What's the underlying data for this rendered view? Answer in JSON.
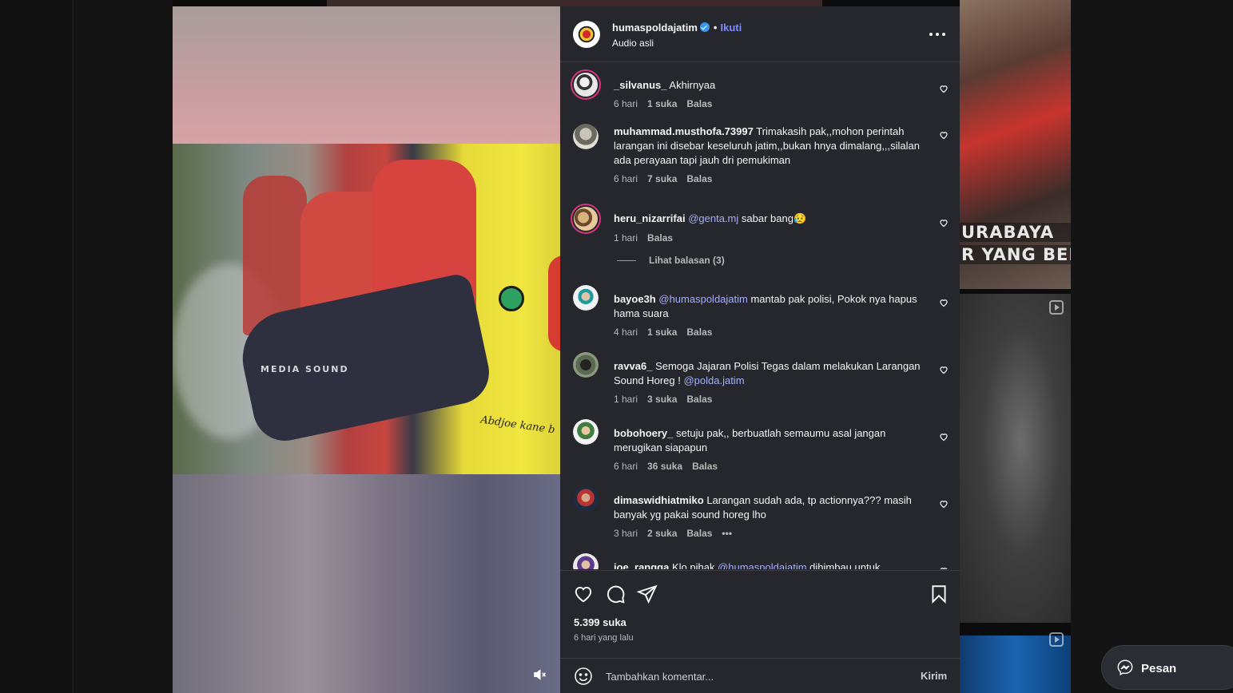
{
  "post": {
    "username": "humaspoldajatim",
    "follow_label": "Ikuti",
    "audio_label": "Audio asli",
    "media_watermark": "MEDIA SOUND",
    "media_bus_text": "Abdjoe kane b"
  },
  "comments": [
    {
      "user": "_silvanus_",
      "text": " Akhirnyaa",
      "meta": {
        "time": "6 hari",
        "likes": "1 suka",
        "reply": "Balas"
      }
    },
    {
      "user": "muhammad.musthofa.73997",
      "text": " Trimakasih pak,,mohon perintah larangan ini disebar keseluruh jatim,,bukan hnya dimalang,,,silalan ada perayaan tapi jauh dri pemukiman",
      "meta": {
        "time": "6 hari",
        "likes": "7 suka",
        "reply": "Balas"
      }
    },
    {
      "user": "heru_nizarrifai",
      "mention": "@genta.mj",
      "text": " sabar bang",
      "emoji": "😥",
      "meta": {
        "time": "1 hari",
        "reply": "Balas"
      },
      "view_replies": "Lihat balasan (3)"
    },
    {
      "user": "bayoe3h",
      "mention": "@humaspoldajatim",
      "text": " mantab pak polisi, Pokok nya hapus hama suara",
      "meta": {
        "time": "4 hari",
        "likes": "1 suka",
        "reply": "Balas"
      }
    },
    {
      "user": "ravva6_",
      "text": " Semoga Jajaran Polisi Tegas dalam melakukan Larangan Sound Horeg ! ",
      "mention": "@polda.jatim",
      "meta": {
        "time": "1 hari",
        "likes": "3 suka",
        "reply": "Balas"
      }
    },
    {
      "user": "bobohoery_",
      "text": " setuju pak,, berbuatlah semaumu asal jangan merugikan siapapun",
      "meta": {
        "time": "6 hari",
        "likes": "36 suka",
        "reply": "Balas"
      }
    },
    {
      "user": "dimaswidhiatmiko",
      "text": " Larangan sudah ada, tp actionnya??? masih banyak yg pakai sound horeg lho",
      "meta": {
        "time": "3 hari",
        "likes": "2 suka",
        "reply": "Balas",
        "more": "•••"
      }
    },
    {
      "user": "joe_rangga",
      "text": " Klo pihak ",
      "mention": "@humaspoldajatim",
      "text2": " dihimbau untuk"
    }
  ],
  "actions": {
    "likes": "5.399 suka",
    "time_ago": "6 hari yang lalu"
  },
  "composer": {
    "placeholder": "Tambahkan komentar...",
    "send_label": "Kirim"
  },
  "background": {
    "caption_line1": "URABAYA",
    "caption_line2": "R YANG BER"
  },
  "messages": {
    "label": "Pesan"
  },
  "colors": {
    "panel_bg": "#25272d",
    "link": "#7d8cf5",
    "mention": "#a4aef8",
    "story_ring": "#d4367e"
  }
}
